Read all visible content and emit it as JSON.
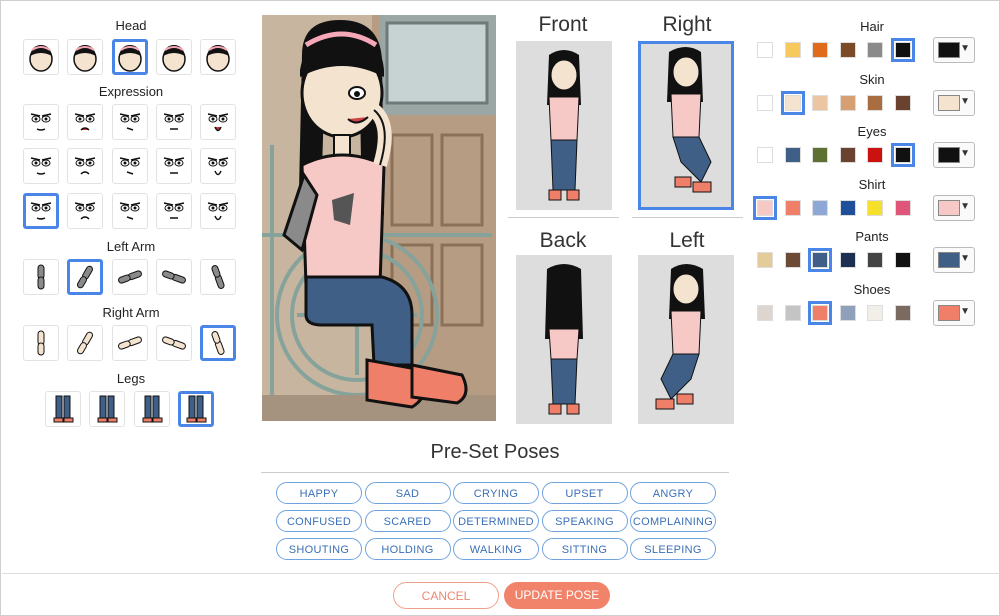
{
  "sections": {
    "head": "Head",
    "expression": "Expression",
    "left_arm": "Left Arm",
    "right_arm": "Right Arm",
    "legs": "Legs"
  },
  "views": {
    "front": "Front",
    "right": "Right",
    "back": "Back",
    "left": "Left"
  },
  "colors": {
    "hair": {
      "label": "Hair",
      "swatches": [
        "#ffffff",
        "#f7c95c",
        "#e06b1a",
        "#7b4a26",
        "#8a8a8a",
        "#111111"
      ],
      "selected": "#111111"
    },
    "skin": {
      "label": "Skin",
      "swatches": [
        "#ffffff",
        "#f3e3cf",
        "#ecc5a2",
        "#d7a072",
        "#a86e42",
        "#6b4230"
      ],
      "selected": "#f3e3cf"
    },
    "eyes": {
      "label": "Eyes",
      "swatches": [
        "#ffffff",
        "#3f5f87",
        "#5e7130",
        "#6b4230",
        "#cc1111",
        "#111111"
      ],
      "selected": "#111111"
    },
    "shirt": {
      "label": "Shirt",
      "swatches": [
        "#f7c9c6",
        "#f07f6a",
        "#8fa7d4",
        "#1f4f9a",
        "#f5df2a",
        "#e0557a"
      ],
      "selected": "#f7c9c6"
    },
    "pants": {
      "label": "Pants",
      "swatches": [
        "#e3cc9a",
        "#6b4a36",
        "#3f5f87",
        "#1e2f54",
        "#444444",
        "#111111"
      ],
      "selected": "#3f5f87"
    },
    "shoes": {
      "label": "Shoes",
      "swatches": [
        "#ddd6d0",
        "#c4c4c4",
        "#f07f6a",
        "#8fa0bb",
        "#f2eee8",
        "#7a6a60"
      ],
      "selected": "#f07f6a"
    }
  },
  "poses": {
    "title": "Pre-Set Poses",
    "buttons": [
      "HAPPY",
      "SAD",
      "CRYING",
      "UPSET",
      "ANGRY",
      "CONFUSED",
      "SCARED",
      "DETERMINED",
      "SPEAKING",
      "COMPLAINING",
      "SHOUTING",
      "HOLDING",
      "WALKING",
      "SITTING",
      "SLEEPING"
    ]
  },
  "actions": {
    "cancel": "CANCEL",
    "update": "UPDATE POSE"
  },
  "accent": "#4a86e8"
}
